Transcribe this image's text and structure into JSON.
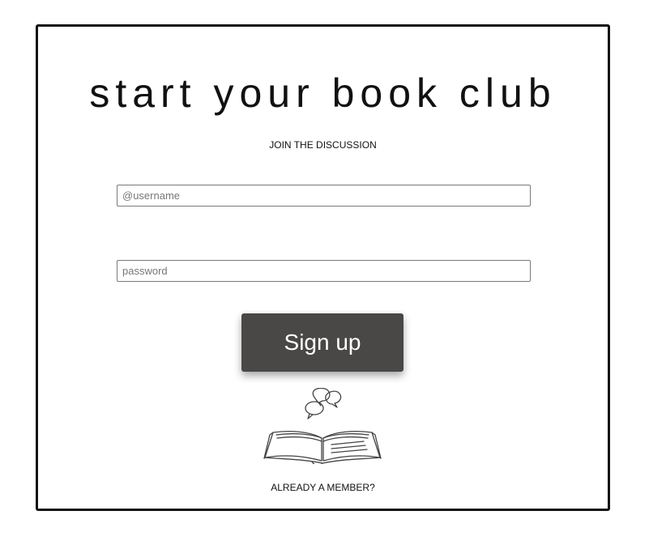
{
  "page": {
    "title": "start your book club",
    "subtitle": "JOIN THE DISCUSSION"
  },
  "form": {
    "username": {
      "placeholder": "@username",
      "value": ""
    },
    "password": {
      "placeholder": "password",
      "value": ""
    },
    "submit_label": "Sign up"
  },
  "footer": {
    "member_link": "ALREADY A MEMBER?"
  },
  "icons": {
    "illustration": "book-with-speech-bubbles-icon"
  },
  "colors": {
    "button_bg": "#4a4747",
    "button_text": "#ffffff",
    "border": "#111111"
  }
}
